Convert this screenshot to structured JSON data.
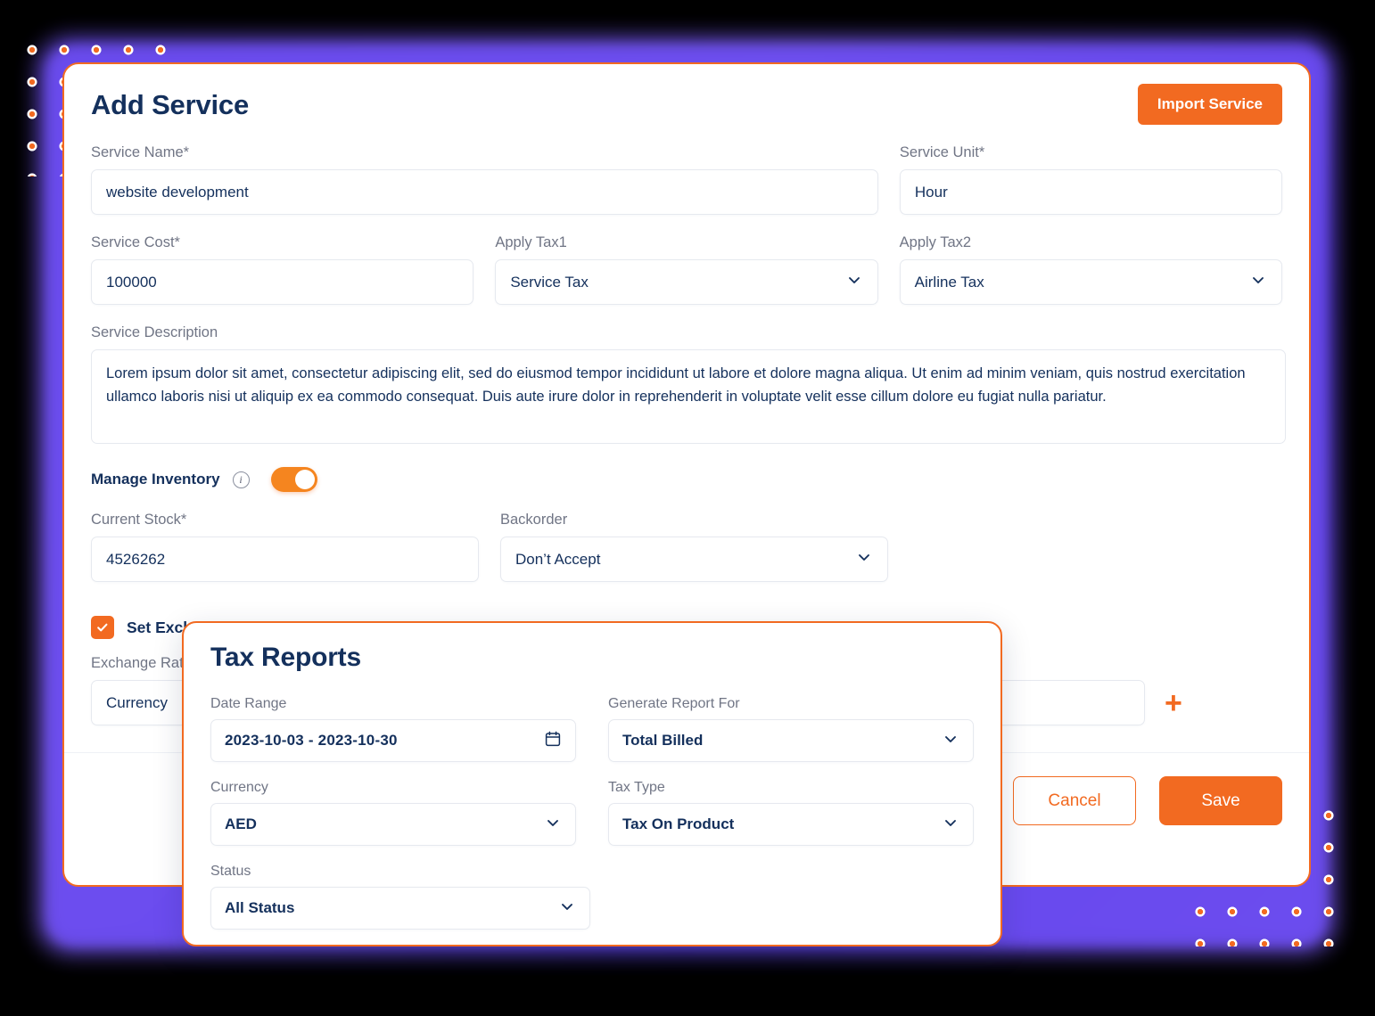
{
  "main_card": {
    "title": "Add Service",
    "import_button": "Import Service",
    "fields": {
      "service_name_label": "Service Name*",
      "service_name_value": "website development",
      "service_unit_label": "Service Unit*",
      "service_unit_value": "Hour",
      "service_cost_label": "Service Cost*",
      "service_cost_value": "100000",
      "apply_tax1_label": "Apply Tax1",
      "apply_tax1_value": "Service Tax",
      "apply_tax2_label": "Apply Tax2",
      "apply_tax2_value": "Airline Tax",
      "service_description_label": "Service Description",
      "service_description_value": "Lorem ipsum dolor sit amet, consectetur adipiscing elit, sed do eiusmod tempor incididunt ut labore et dolore magna aliqua. Ut enim ad minim veniam, quis nostrud exercitation ullamco laboris nisi ut aliquip ex ea commodo consequat. Duis aute irure dolor in reprehenderit in voluptate velit esse cillum dolore eu fugiat nulla pariatur.",
      "manage_inventory_label": "Manage Inventory",
      "manage_inventory_state": "on",
      "current_stock_label": "Current Stock*",
      "current_stock_value": "4526262",
      "backorder_label": "Backorder",
      "backorder_value": "Don’t Accept",
      "set_exchange_rate_label": "Set Exchange Rate",
      "set_exchange_rate_checked": "true",
      "exchange_rate_label": "Exchange Rate",
      "currency_value": "Currency",
      "add_rate_icon": "+"
    },
    "actions": {
      "cancel": "Cancel",
      "save": "Save"
    }
  },
  "tax_reports_card": {
    "title": "Tax Reports",
    "date_range_label": "Date Range",
    "date_range_value": "2023-10-03 - 2023-10-30",
    "generate_report_for_label": "Generate Report For",
    "generate_report_for_value": "Total Billed",
    "currency_label": "Currency",
    "currency_value": "AED",
    "tax_type_label": "Tax Type",
    "tax_type_value": "Tax On Product",
    "status_label": "Status",
    "status_value": "All Status"
  },
  "icons": {
    "calendar": "calendar-icon",
    "chevron_down": "chevron-down-icon",
    "info": "info-icon",
    "check": "check-icon",
    "plus": "plus-icon"
  },
  "colors": {
    "accent_orange": "#f26a21",
    "toggle_orange": "#f5851f",
    "text_navy": "#14305c",
    "label_gray": "#707585",
    "border_gray": "#e6e9ef",
    "glow_purple": "#6b4bf2",
    "background": "#000000"
  }
}
